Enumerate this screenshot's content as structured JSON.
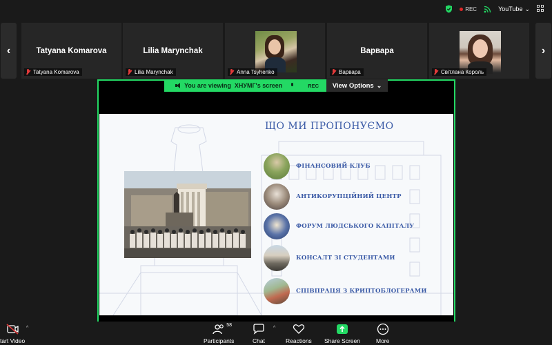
{
  "top_bar": {
    "rec_label": "REC",
    "youtube_label": "YouTube",
    "accent_green": "#23d964"
  },
  "participants": [
    {
      "big_name": "Tatyana Komarova",
      "label": "Tatyana Komarova",
      "video": false
    },
    {
      "big_name": "Lilia Marynchak",
      "label": "Lilia Marynchak",
      "video": false
    },
    {
      "big_name": "",
      "label": "Anna Tsyhenko",
      "video": true
    },
    {
      "big_name": "Варвара",
      "label": "Варвара",
      "video": false
    },
    {
      "big_name": "",
      "label": "Світлана Король",
      "video": true
    }
  ],
  "share_bar": {
    "viewing_text": "You are viewing",
    "viewing_name": "ХНУМГ's screen",
    "rec_label": "REC",
    "view_options": "View Options"
  },
  "slide": {
    "title": "ЩО МИ ПРОПОНУЄМО",
    "offers": [
      "ФІНАНСОВИЙ КЛУБ",
      "АНТИКОРУПЦІЙНИЙ ЦЕНТР",
      "ФОРУМ ЛЮДСЬКОГО КАПІТАЛУ",
      "КОНСАЛТ ЗІ СТУДЕНТАМИ",
      "СПІВПРАЦЯ З КРИПТОБЛОГЕРАМИ"
    ],
    "accent_color": "#3a5aa6"
  },
  "toolbar": {
    "start_video": "tart Video",
    "participants": "Participants",
    "participants_count": "58",
    "chat": "Chat",
    "reactions": "Reactions",
    "share_screen": "Share Screen",
    "more": "More"
  }
}
